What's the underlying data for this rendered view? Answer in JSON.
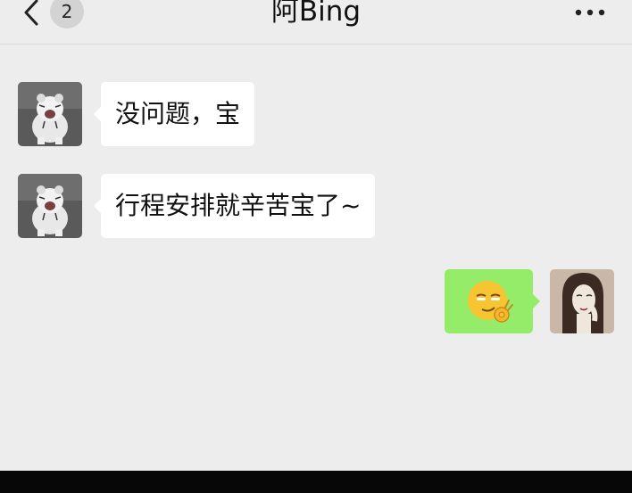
{
  "header": {
    "back_icon": "chevron-left-icon",
    "unread_count": "2",
    "title": "阿Bing",
    "more_icon": "more-dots-icon"
  },
  "messages": [
    {
      "direction": "incoming",
      "sender_avatar": "white-tiger-cub-photo",
      "text": "没问题，宝"
    },
    {
      "direction": "incoming",
      "sender_avatar": "white-tiger-cub-photo",
      "text": "行程安排就辛苦宝了~"
    },
    {
      "direction": "outgoing",
      "sender_avatar": "woman-sketch-portrait",
      "sticker": "smirk-ok-hand-emoji"
    }
  ],
  "colors": {
    "background": "#ededed",
    "incoming_bubble": "#ffffff",
    "outgoing_bubble": "#95ec69",
    "badge": "#d3d3d3"
  }
}
